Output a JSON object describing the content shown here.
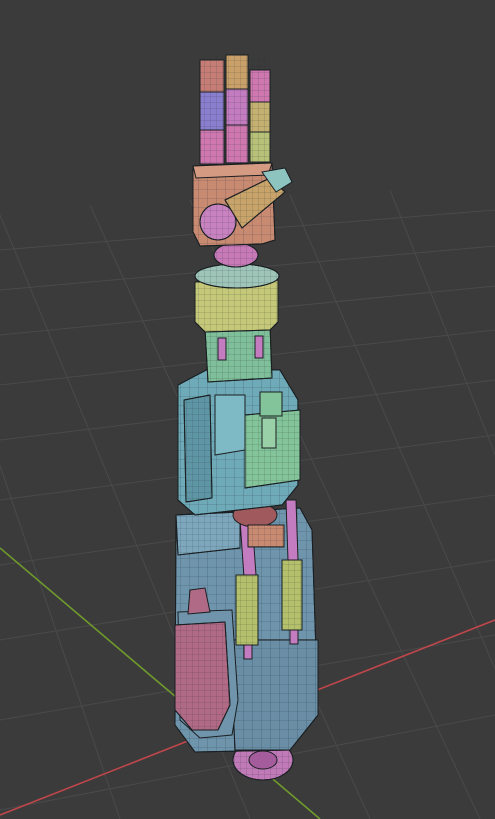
{
  "viewport": {
    "kind": "3d-viewport",
    "shading": "solid-wireframe",
    "background_color": "#3b3b3b",
    "grid_color": "#4a4a4a",
    "x_axis_color": "#c0464a",
    "y_axis_color": "#6f9a2c"
  },
  "model": {
    "parts": [
      {
        "name": "finger-1",
        "color": "#c57d76"
      },
      {
        "name": "finger-2",
        "color": "#c9a06a"
      },
      {
        "name": "finger-3",
        "color": "#cf78b0"
      },
      {
        "name": "finger-4",
        "color": "#b7c178"
      },
      {
        "name": "finger-segment-mid",
        "color": "#8a7fcf"
      },
      {
        "name": "palm",
        "color": "#c98a72"
      },
      {
        "name": "thumb",
        "color": "#c8a36a"
      },
      {
        "name": "thumb-base",
        "color": "#c882c0"
      },
      {
        "name": "wrist-joint",
        "color": "#c87ab8"
      },
      {
        "name": "wrist-ring",
        "color": "#9fc4b8"
      },
      {
        "name": "forearm-ring",
        "color": "#c4c878"
      },
      {
        "name": "forearm-tube",
        "color": "#7fbf9a"
      },
      {
        "name": "upper-housing",
        "color": "#6faab8"
      },
      {
        "name": "inner-core",
        "color": "#84c49a"
      },
      {
        "name": "pistons",
        "color": "#b4c06c"
      },
      {
        "name": "piston-rods",
        "color": "#c47cc0"
      },
      {
        "name": "lower-housing",
        "color": "#6f95ad"
      },
      {
        "name": "side-plate",
        "color": "#b06a86"
      },
      {
        "name": "base-wheel",
        "color": "#c07ab8"
      }
    ]
  }
}
